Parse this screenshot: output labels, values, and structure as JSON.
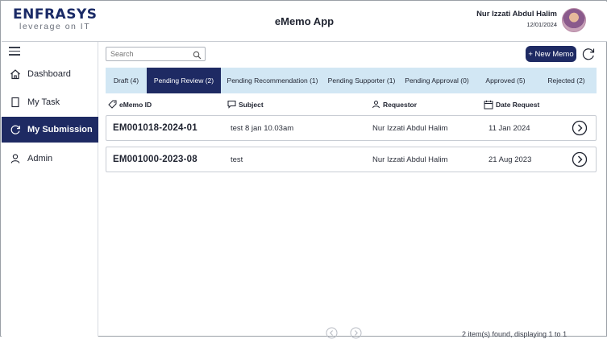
{
  "header": {
    "logo_main": "ENFRASYS",
    "logo_sub": "leverage on IT",
    "app_title": "eMemo App",
    "user_name": "Nur Izzati Abdul Halim",
    "date": "12/01/2024"
  },
  "sidebar": {
    "items": [
      {
        "label": "Dashboard",
        "icon": "home-icon",
        "active": false
      },
      {
        "label": "My Task",
        "icon": "task-icon",
        "active": false
      },
      {
        "label": "My Submission",
        "icon": "refresh-icon",
        "active": true
      },
      {
        "label": "Admin",
        "icon": "user-icon",
        "active": false
      }
    ]
  },
  "toolbar": {
    "search_placeholder": "Search",
    "new_memo_label": "+ New Memo"
  },
  "tabs": [
    {
      "label": "Draft (4)",
      "active": false
    },
    {
      "label": "Pending Review (2)",
      "active": true
    },
    {
      "label": "Pending Recommendation (1)",
      "active": false
    },
    {
      "label": "Pending Supporter (1)",
      "active": false
    },
    {
      "label": "Pending Approval (0)",
      "active": false
    },
    {
      "label": "Approved (5)",
      "active": false
    },
    {
      "label": "Rejected (2)",
      "active": false
    }
  ],
  "columns": {
    "ememo_id": "eMemo ID",
    "subject": "Subject",
    "requestor": "Requestor",
    "date_request": "Date Request"
  },
  "rows": [
    {
      "id": "EM001018-2024-01",
      "subject": "test 8 jan 10.03am",
      "requestor": "Nur Izzati Abdul Halim",
      "date": "11 Jan 2024"
    },
    {
      "id": "EM001000-2023-08",
      "subject": "test",
      "requestor": "Nur Izzati Abdul Halim",
      "date": "21 Aug 2023"
    }
  ],
  "footer": {
    "found_text": "2 item(s) found, displaying 1 to 1"
  },
  "colors": {
    "primary": "#1e2a63",
    "tab_bar": "#d2e7f4"
  }
}
